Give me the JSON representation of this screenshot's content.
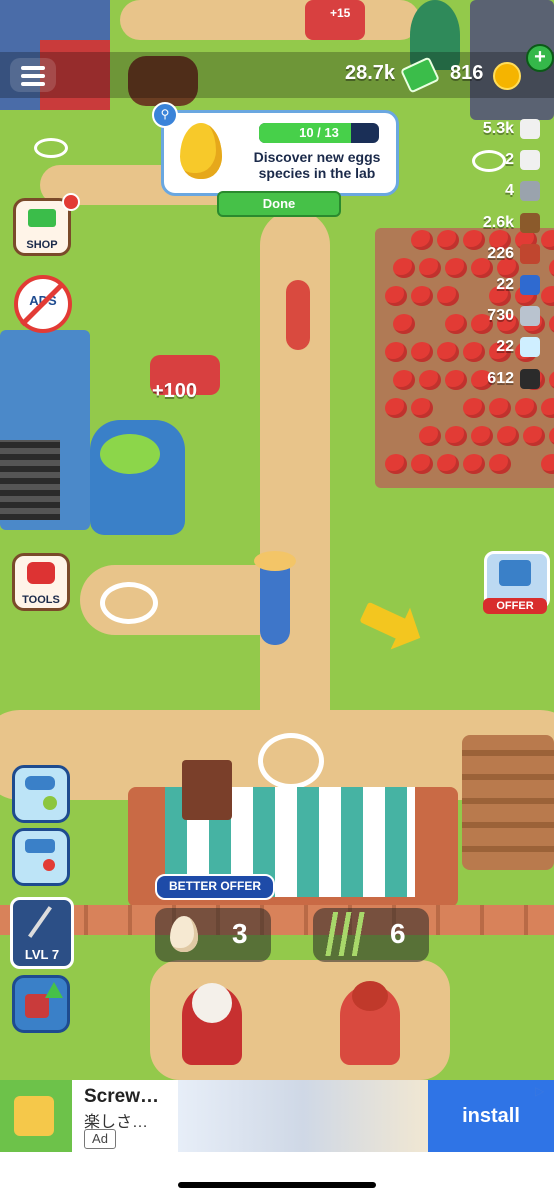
{
  "hud": {
    "cash": "28.7k",
    "coins": "816",
    "plus": "+",
    "cart_bonus": "+15"
  },
  "quest": {
    "progress": "10 / 13",
    "progress_fraction": 0.77,
    "text": "Discover new eggs species in the lab",
    "done_label": "Done",
    "search_icon": "search-icon"
  },
  "resources": [
    {
      "value": "5.3k",
      "icon": "ring-icon",
      "color": "#f0f0f0"
    },
    {
      "value": "2",
      "icon": "horseshoe-icon",
      "color": "#f0f0f0"
    },
    {
      "value": "4",
      "icon": "bolt-icon",
      "color": "#9aa3ad"
    },
    {
      "value": "2.6k",
      "icon": "wood-log-icon",
      "color": "#8b5a2b"
    },
    {
      "value": "226",
      "icon": "brick-icon",
      "color": "#c0462f"
    },
    {
      "value": "22",
      "icon": "blueprint-icon",
      "color": "#2f6ad0"
    },
    {
      "value": "730",
      "icon": "steel-ingot-icon",
      "color": "#b9c3cf"
    },
    {
      "value": "22",
      "icon": "diamond-icon",
      "color": "#cfefff"
    },
    {
      "value": "612",
      "icon": "coal-icon",
      "color": "#2b2b2b"
    }
  ],
  "side_buttons": {
    "shop": "SHOP",
    "ads": "ADS",
    "tools": "TOOLS",
    "level": "LVL 7"
  },
  "world": {
    "wheelbarrow_bonus": "+100",
    "offer_label": "OFFER"
  },
  "stall": {
    "better_offer": "BETTER OFFER",
    "egg_request": "3",
    "bamboo_request": "6"
  },
  "ad": {
    "title": "Screw…",
    "subtitle": "楽しさ…",
    "tag": "Ad",
    "install": "install"
  }
}
